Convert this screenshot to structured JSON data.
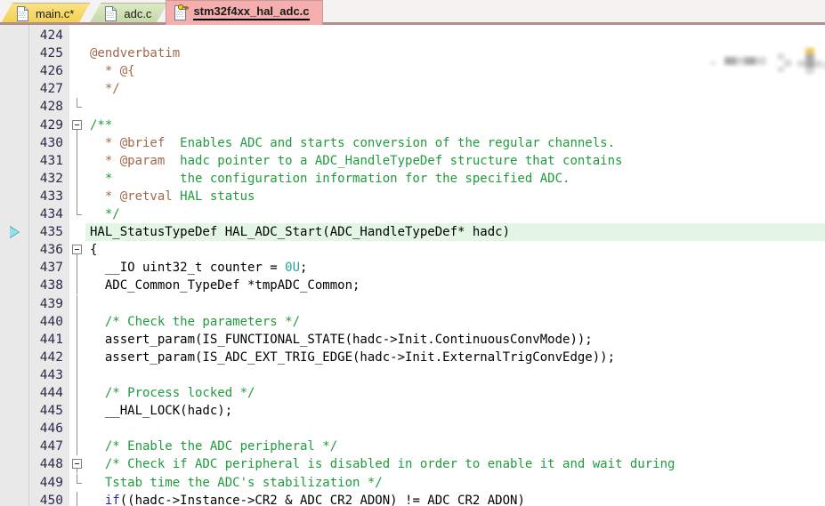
{
  "window": {
    "title": "stm32f4xx_hal_adc.c"
  },
  "tabbar": {
    "tabs": [
      {
        "label": "main.c*",
        "icon": "c-file-icon",
        "state": "modified",
        "color": "#f6d96b",
        "active": false
      },
      {
        "label": "adc.c",
        "icon": "c-file-icon",
        "state": "saved",
        "color": "#cfe0b4",
        "active": false
      },
      {
        "label": "stm32f4xx_hal_adc.c",
        "icon": "c-file-readonly-icon",
        "state": "read-only",
        "color": "#f4aeae",
        "active": true
      }
    ]
  },
  "editor": {
    "first_line": 424,
    "highlighted_line": 435,
    "marker_line": 435,
    "marker_icon": "execution-pointer-arrow",
    "colors": {
      "comment": "#1f9b3c",
      "doctag": "#a06a4a",
      "number": "#2aa0a0",
      "keyword": "#2222cc",
      "highlight_bg": "#e3f5e3",
      "gutter_bg": "#e9e9e9"
    },
    "lines": [
      {
        "n": 424,
        "fold": "none",
        "tokens": []
      },
      {
        "n": 425,
        "fold": "none",
        "tokens": [
          {
            "t": "@endverbatim",
            "c": "doctag"
          }
        ]
      },
      {
        "n": 426,
        "fold": "none",
        "tokens": [
          {
            "t": "  * @{",
            "c": "doctag"
          }
        ]
      },
      {
        "n": 427,
        "fold": "none",
        "tokens": [
          {
            "t": "  */",
            "c": "doctag"
          }
        ]
      },
      {
        "n": 428,
        "fold": "end",
        "tokens": []
      },
      {
        "n": 429,
        "fold": "start",
        "tokens": [
          {
            "t": "/**",
            "c": "comment"
          }
        ]
      },
      {
        "n": 430,
        "fold": "bar",
        "tokens": [
          {
            "t": "  * ",
            "c": "doctag"
          },
          {
            "t": "@brief",
            "c": "doctag"
          },
          {
            "t": "  Enables ADC and starts conversion of the regular channels.",
            "c": "comment"
          }
        ]
      },
      {
        "n": 431,
        "fold": "bar",
        "tokens": [
          {
            "t": "  * ",
            "c": "doctag"
          },
          {
            "t": "@param",
            "c": "doctag"
          },
          {
            "t": "  hadc pointer to a ADC_HandleTypeDef structure that contains",
            "c": "comment"
          }
        ]
      },
      {
        "n": 432,
        "fold": "bar",
        "tokens": [
          {
            "t": "  *         the configuration information for the specified ADC.",
            "c": "comment"
          }
        ]
      },
      {
        "n": 433,
        "fold": "bar",
        "tokens": [
          {
            "t": "  * ",
            "c": "doctag"
          },
          {
            "t": "@retval",
            "c": "doctag"
          },
          {
            "t": " HAL status",
            "c": "comment"
          }
        ]
      },
      {
        "n": 434,
        "fold": "end",
        "tokens": [
          {
            "t": "  */",
            "c": "comment"
          }
        ]
      },
      {
        "n": 435,
        "fold": "none",
        "tokens": [
          {
            "t": "HAL_StatusTypeDef HAL_ADC_Start(ADC_HandleTypeDef* hadc)",
            "c": "plain"
          }
        ]
      },
      {
        "n": 436,
        "fold": "start",
        "tokens": [
          {
            "t": "{",
            "c": "plain"
          }
        ]
      },
      {
        "n": 437,
        "fold": "bar",
        "tokens": [
          {
            "t": "  __IO uint32_t counter = ",
            "c": "plain"
          },
          {
            "t": "0U",
            "c": "num"
          },
          {
            "t": ";",
            "c": "plain"
          }
        ]
      },
      {
        "n": 438,
        "fold": "bar",
        "tokens": [
          {
            "t": "  ADC_Common_TypeDef *tmpADC_Common;",
            "c": "plain"
          }
        ]
      },
      {
        "n": 439,
        "fold": "bar",
        "tokens": []
      },
      {
        "n": 440,
        "fold": "bar",
        "tokens": [
          {
            "t": "  /* Check the parameters */",
            "c": "comment"
          }
        ]
      },
      {
        "n": 441,
        "fold": "bar",
        "tokens": [
          {
            "t": "  assert_param(IS_FUNCTIONAL_STATE(hadc->Init.ContinuousConvMode));",
            "c": "plain"
          }
        ]
      },
      {
        "n": 442,
        "fold": "bar",
        "tokens": [
          {
            "t": "  assert_param(IS_ADC_EXT_TRIG_EDGE(hadc->Init.ExternalTrigConvEdge));",
            "c": "plain"
          }
        ]
      },
      {
        "n": 443,
        "fold": "bar",
        "tokens": []
      },
      {
        "n": 444,
        "fold": "bar",
        "tokens": [
          {
            "t": "  /* Process locked */",
            "c": "comment"
          }
        ]
      },
      {
        "n": 445,
        "fold": "bar",
        "tokens": [
          {
            "t": "  __HAL_LOCK(hadc);",
            "c": "plain"
          }
        ]
      },
      {
        "n": 446,
        "fold": "bar",
        "tokens": []
      },
      {
        "n": 447,
        "fold": "bar",
        "tokens": [
          {
            "t": "  /* Enable the ADC peripheral */",
            "c": "comment"
          }
        ]
      },
      {
        "n": 448,
        "fold": "start",
        "tokens": [
          {
            "t": "  /* Check if ADC peripheral is disabled in order to enable it and wait during",
            "c": "comment"
          }
        ]
      },
      {
        "n": 449,
        "fold": "end",
        "tokens": [
          {
            "t": "  Tstab time the ADC's stabilization */",
            "c": "comment"
          }
        ]
      },
      {
        "n": 450,
        "fold": "bar",
        "tokens": [
          {
            "t": "  if",
            "c": "kw"
          },
          {
            "t": "((hadc->Instance->CR2 & ADC_CR2_ADON) != ADC_CR2_ADON)",
            "c": "plain"
          }
        ]
      }
    ]
  }
}
